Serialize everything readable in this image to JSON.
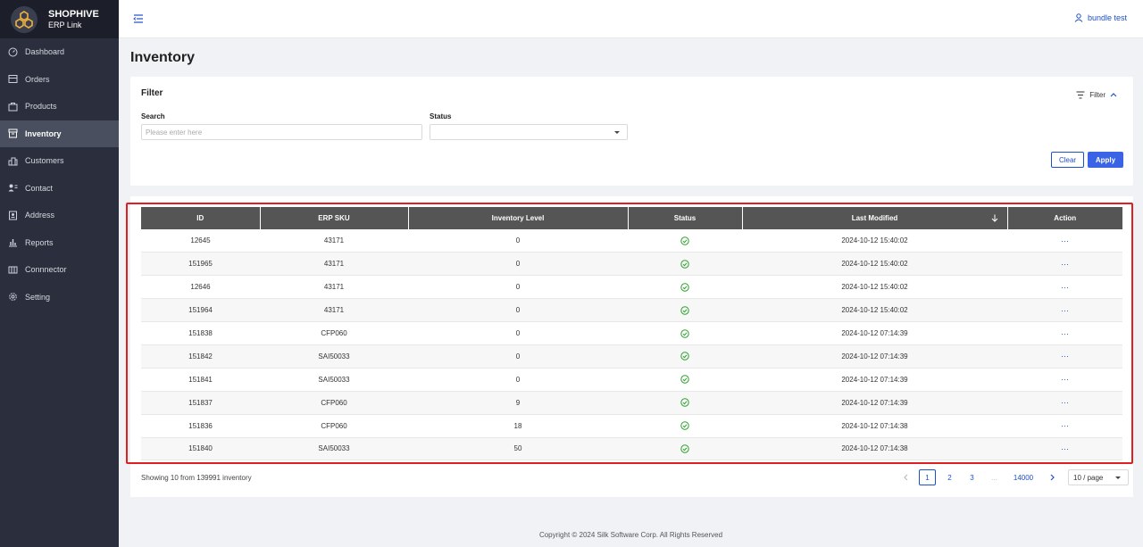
{
  "brand": {
    "name": "SHOPHIVE",
    "sub": "ERP Link"
  },
  "sidebar": {
    "items": [
      {
        "label": "Dashboard",
        "icon": "dashboard-icon"
      },
      {
        "label": "Orders",
        "icon": "orders-icon"
      },
      {
        "label": "Products",
        "icon": "products-icon"
      },
      {
        "label": "Inventory",
        "icon": "inventory-icon",
        "active": true
      },
      {
        "label": "Customers",
        "icon": "customers-icon"
      },
      {
        "label": "Contact",
        "icon": "contact-icon"
      },
      {
        "label": "Address",
        "icon": "address-icon"
      },
      {
        "label": "Reports",
        "icon": "reports-icon"
      },
      {
        "label": "Connnector",
        "icon": "connector-icon"
      },
      {
        "label": "Setting",
        "icon": "gear-icon"
      }
    ]
  },
  "header": {
    "user": "bundle test"
  },
  "page": {
    "title": "Inventory"
  },
  "filter": {
    "title": "Filter",
    "toggle_label": "Filter",
    "search_label": "Search",
    "search_placeholder": "Please enter here",
    "search_value": "",
    "status_label": "Status",
    "status_value": "",
    "clear_label": "Clear",
    "apply_label": "Apply"
  },
  "table": {
    "columns": [
      "ID",
      "ERP SKU",
      "Inventory Level",
      "Status",
      "Last Modified",
      "Action"
    ],
    "rows": [
      {
        "id": "12645",
        "sku": "43171",
        "level": "0",
        "status": "ok",
        "modified": "2024-10-12 15:40:02",
        "action": "···"
      },
      {
        "id": "151965",
        "sku": "43171",
        "level": "0",
        "status": "ok",
        "modified": "2024-10-12 15:40:02",
        "action": "···"
      },
      {
        "id": "12646",
        "sku": "43171",
        "level": "0",
        "status": "ok",
        "modified": "2024-10-12 15:40:02",
        "action": "···"
      },
      {
        "id": "151964",
        "sku": "43171",
        "level": "0",
        "status": "ok",
        "modified": "2024-10-12 15:40:02",
        "action": "···"
      },
      {
        "id": "151838",
        "sku": "CFP060",
        "level": "0",
        "status": "ok",
        "modified": "2024-10-12 07:14:39",
        "action": "···"
      },
      {
        "id": "151842",
        "sku": "SAI50033",
        "level": "0",
        "status": "ok",
        "modified": "2024-10-12 07:14:39",
        "action": "···"
      },
      {
        "id": "151841",
        "sku": "SAI50033",
        "level": "0",
        "status": "ok",
        "modified": "2024-10-12 07:14:39",
        "action": "···"
      },
      {
        "id": "151837",
        "sku": "CFP060",
        "level": "9",
        "status": "ok",
        "modified": "2024-10-12 07:14:39",
        "action": "···"
      },
      {
        "id": "151836",
        "sku": "CFP060",
        "level": "18",
        "status": "ok",
        "modified": "2024-10-12 07:14:38",
        "action": "···"
      },
      {
        "id": "151840",
        "sku": "SAI50033",
        "level": "50",
        "status": "ok",
        "modified": "2024-10-12 07:14:38",
        "action": "···"
      }
    ]
  },
  "pagination": {
    "summary": "Showing 10 from 139991 inventory",
    "pages": [
      "1",
      "2",
      "3",
      "...",
      "14000"
    ],
    "current": "1",
    "page_size": "10 / page"
  },
  "footer": {
    "copyright": "Copyright © 2024 Silk Software Corp. All Rights Reserved"
  },
  "colors": {
    "sidebar_bg": "#2b2f3d",
    "accent": "#3a63e6",
    "highlight": "#e02020",
    "status_ok": "#2ca02c"
  }
}
